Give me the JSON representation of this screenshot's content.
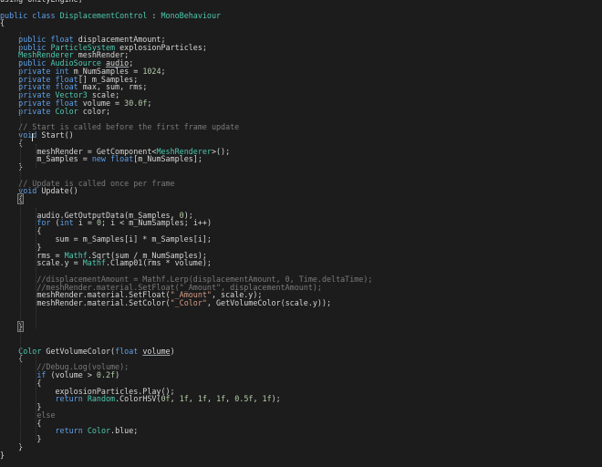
{
  "editor": {
    "lines": [
      [
        [
          "using UnityEngine;",
          ""
        ]
      ],
      [
        [
          "",
          ""
        ]
      ],
      [
        [
          "public class ",
          "k"
        ],
        [
          "DisplacementControl",
          "t"
        ],
        [
          " : ",
          ""
        ],
        [
          "MonoBehaviour",
          "t"
        ]
      ],
      [
        [
          "{",
          ""
        ]
      ],
      [
        [
          "",
          ""
        ]
      ],
      [
        [
          "    public float ",
          "k"
        ],
        [
          "displacementAmount;",
          ""
        ]
      ],
      [
        [
          "    public ",
          "k"
        ],
        [
          "ParticleSystem",
          "t"
        ],
        [
          " explosionParticles;",
          ""
        ]
      ],
      [
        [
          "    MeshRenderer",
          "t"
        ],
        [
          " meshRender;",
          ""
        ]
      ],
      [
        [
          "    public ",
          "k"
        ],
        [
          "AudioSource",
          "t"
        ],
        [
          " ",
          ""
        ],
        [
          "audio",
          "u"
        ],
        [
          ";",
          ""
        ]
      ],
      [
        [
          "    private int ",
          "k"
        ],
        [
          "m_NumSamples = ",
          ""
        ],
        [
          "1024",
          "n"
        ],
        [
          ";",
          ""
        ]
      ],
      [
        [
          "    private float",
          "k"
        ],
        [
          "[] m_Samples;",
          ""
        ]
      ],
      [
        [
          "    private float ",
          "k"
        ],
        [
          "max, sum, rms;",
          ""
        ]
      ],
      [
        [
          "    private ",
          "k"
        ],
        [
          "Vector3",
          "t"
        ],
        [
          " scale;",
          ""
        ]
      ],
      [
        [
          "    private float ",
          "k"
        ],
        [
          "volume = ",
          ""
        ],
        [
          "30.0f",
          "n"
        ],
        [
          ";",
          ""
        ]
      ],
      [
        [
          "    private ",
          "k"
        ],
        [
          "Color",
          "t"
        ],
        [
          " color;",
          ""
        ]
      ],
      [
        [
          "",
          ""
        ]
      ],
      [
        [
          "    // Start is called before the first frame update",
          "cg"
        ]
      ],
      [
        [
          "    ",
          ""
        ],
        [
          "void",
          "k"
        ],
        [
          " Start()",
          ""
        ]
      ],
      [
        [
          "    {",
          ""
        ]
      ],
      [
        [
          "        meshRender = GetComponent<",
          ""
        ],
        [
          "MeshRenderer",
          "t"
        ],
        [
          ">();",
          ""
        ]
      ],
      [
        [
          "        m_Samples = ",
          ""
        ],
        [
          "new float",
          "k"
        ],
        [
          "[m_NumSamples];",
          ""
        ]
      ],
      [
        [
          "    }",
          ""
        ]
      ],
      [
        [
          "",
          ""
        ]
      ],
      [
        [
          "    // Update is called once per frame",
          "cg"
        ]
      ],
      [
        [
          "    ",
          ""
        ],
        [
          "void",
          "k"
        ],
        [
          " Update()",
          ""
        ]
      ],
      [
        [
          "    ",
          ""
        ],
        [
          "{",
          "brace-hl"
        ]
      ],
      [
        [
          "",
          ""
        ]
      ],
      [
        [
          "        audio.GetOutputData(m_Samples, ",
          ""
        ],
        [
          "0",
          "n"
        ],
        [
          ");",
          ""
        ]
      ],
      [
        [
          "        ",
          ""
        ],
        [
          "for",
          "k"
        ],
        [
          " (",
          ""
        ],
        [
          "int",
          "k"
        ],
        [
          " i = ",
          ""
        ],
        [
          "0",
          "n"
        ],
        [
          "; i < m_NumSamples; i++)",
          ""
        ]
      ],
      [
        [
          "        {",
          ""
        ]
      ],
      [
        [
          "            sum = m_Samples[i] * m_Samples[i];",
          ""
        ]
      ],
      [
        [
          "        }",
          ""
        ]
      ],
      [
        [
          "        rms = ",
          ""
        ],
        [
          "Mathf",
          "t"
        ],
        [
          ".Sqrt(sum / m_NumSamples);",
          ""
        ]
      ],
      [
        [
          "        scale.y = ",
          ""
        ],
        [
          "Mathf",
          "t"
        ],
        [
          ".Clamp01(rms * volume);",
          ""
        ]
      ],
      [
        [
          "",
          ""
        ]
      ],
      [
        [
          "        //displacementAmount = Mathf.Lerp(displacementAmount, 0, Time.deltaTime);",
          "cg"
        ]
      ],
      [
        [
          "        //meshRender.material.SetFloat(\"_Amount\", displacementAmount);",
          "cg"
        ]
      ],
      [
        [
          "        meshRender.material.SetFloat(",
          ""
        ],
        [
          "\"_Amount\"",
          "s"
        ],
        [
          ", scale.y);",
          ""
        ]
      ],
      [
        [
          "        meshRender.material.SetColor(",
          ""
        ],
        [
          "\"_Color\"",
          "s"
        ],
        [
          ", GetVolumeColor(scale.y));",
          ""
        ]
      ],
      [
        [
          "",
          ""
        ]
      ],
      [
        [
          "",
          ""
        ]
      ],
      [
        [
          "    ",
          ""
        ],
        [
          "}",
          "brace-hl"
        ]
      ],
      [
        [
          "",
          ""
        ]
      ],
      [
        [
          "",
          ""
        ]
      ],
      [
        [
          "    ",
          ""
        ],
        [
          "Color",
          "t"
        ],
        [
          " GetVolumeColor(",
          ""
        ],
        [
          "float",
          "k"
        ],
        [
          " ",
          ""
        ],
        [
          "volume",
          "u"
        ],
        [
          ")",
          ""
        ]
      ],
      [
        [
          "    {",
          ""
        ]
      ],
      [
        [
          "        //Debug.Log(volume);",
          "cg"
        ]
      ],
      [
        [
          "        ",
          ""
        ],
        [
          "if",
          "k"
        ],
        [
          " (volume > ",
          ""
        ],
        [
          "0.2f",
          "n"
        ],
        [
          ")",
          ""
        ]
      ],
      [
        [
          "        {",
          ""
        ]
      ],
      [
        [
          "            explosionParticles.Play();",
          ""
        ]
      ],
      [
        [
          "            ",
          ""
        ],
        [
          "return",
          "k"
        ],
        [
          " ",
          ""
        ],
        [
          "Random",
          "t"
        ],
        [
          ".ColorHSV(",
          ""
        ],
        [
          "0f",
          "n"
        ],
        [
          ", ",
          ""
        ],
        [
          "1f",
          "n"
        ],
        [
          ", ",
          ""
        ],
        [
          "1f",
          "n"
        ],
        [
          ", ",
          ""
        ],
        [
          "1f",
          "n"
        ],
        [
          ", ",
          ""
        ],
        [
          "0.5f",
          "n"
        ],
        [
          ", ",
          ""
        ],
        [
          "1f",
          "n"
        ],
        [
          ");",
          ""
        ]
      ],
      [
        [
          "        }",
          ""
        ]
      ],
      [
        [
          "        ",
          ""
        ],
        [
          "else",
          "cg"
        ]
      ],
      [
        [
          "        {",
          ""
        ]
      ],
      [
        [
          "            ",
          ""
        ],
        [
          "return",
          "k"
        ],
        [
          " ",
          ""
        ],
        [
          "Color",
          "t"
        ],
        [
          ".blue;",
          ""
        ]
      ],
      [
        [
          "        }",
          ""
        ]
      ],
      [
        [
          "    }",
          ""
        ]
      ],
      [
        [
          "}",
          ""
        ]
      ]
    ]
  }
}
